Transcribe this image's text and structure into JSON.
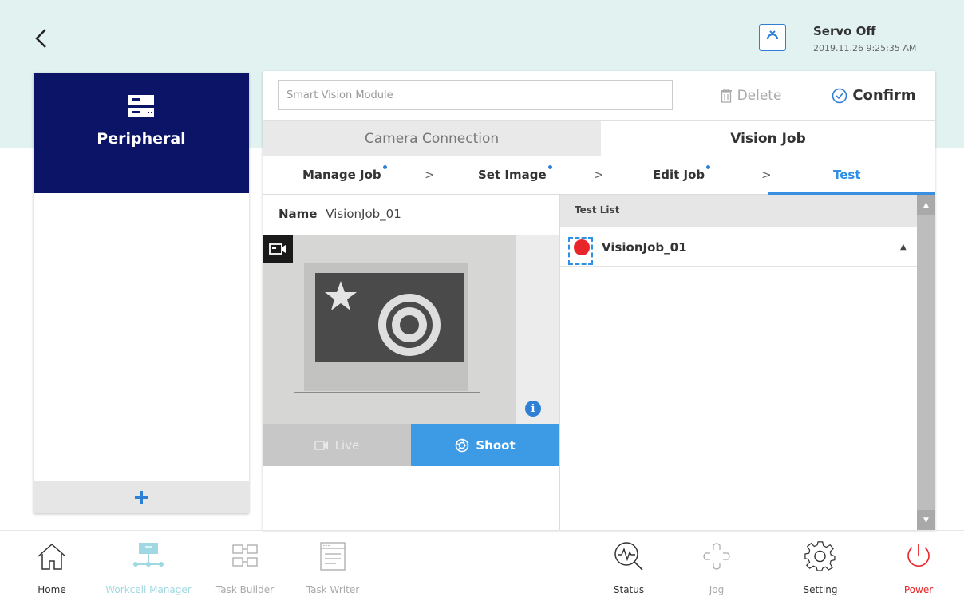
{
  "header": {
    "servo_status": "Servo Off",
    "timestamp": "2019.11.26 9:25:35 AM"
  },
  "left_panel": {
    "category_label": "Peripheral",
    "add_symbol": "+"
  },
  "main": {
    "module_placeholder": "Smart Vision Module",
    "delete_label": "Delete",
    "confirm_label": "Confirm",
    "tabs": [
      {
        "label": "Camera Connection",
        "active": false
      },
      {
        "label": "Vision Job",
        "active": true
      }
    ],
    "steps": [
      {
        "label": "Manage Job",
        "done": true
      },
      {
        "label": "Set Image",
        "done": true
      },
      {
        "label": "Edit Job",
        "done": true
      },
      {
        "label": "Test",
        "active": true
      }
    ],
    "step_separator": ">",
    "name_label": "Name",
    "name_value": "VisionJob_01",
    "live_label": "Live",
    "shoot_label": "Shoot",
    "info_symbol": "i",
    "test_list": {
      "header": "Test List",
      "items": [
        {
          "name": "VisionJob_01",
          "status_color": "#e8262a",
          "expand_symbol": "▲"
        }
      ]
    }
  },
  "bottom_nav": [
    {
      "label": "Home",
      "icon": "home-icon",
      "color": "#333333"
    },
    {
      "label": "Workcell Manager",
      "icon": "workcell-icon",
      "color": "#9fd8e2"
    },
    {
      "label": "Task Builder",
      "icon": "task-builder-icon",
      "color": "#aaaaaa"
    },
    {
      "label": "Task Writer",
      "icon": "task-writer-icon",
      "color": "#aaaaaa"
    },
    {
      "label": "Status",
      "icon": "status-icon",
      "color": "#333333"
    },
    {
      "label": "Jog",
      "icon": "jog-icon",
      "color": "#aaaaaa"
    },
    {
      "label": "Setting",
      "icon": "gear-icon",
      "color": "#333333"
    },
    {
      "label": "Power",
      "icon": "power-icon",
      "color": "#e8262a"
    }
  ],
  "colors": {
    "accent": "#2e90e6",
    "peripheral_bg": "#0b1466",
    "header_bg": "#e2f2f1"
  }
}
